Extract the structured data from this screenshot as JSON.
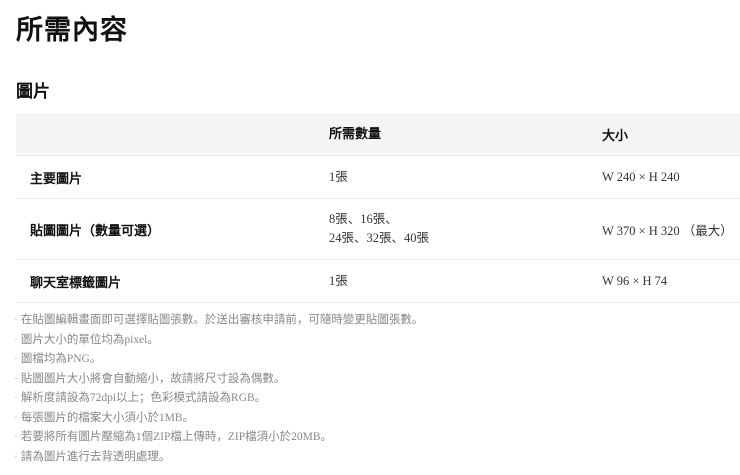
{
  "title": "所需內容",
  "section": "圖片",
  "table": {
    "headers": [
      "",
      "所需數量",
      "大小"
    ],
    "rows": [
      {
        "name": "主要圖片",
        "qty": [
          "1張"
        ],
        "size": "W 240 × H 240"
      },
      {
        "name": "貼圖圖片（數量可選）",
        "qty": [
          "8張、16張、",
          "24張、32張、40張"
        ],
        "size": "W 370 × H 320 （最大）"
      },
      {
        "name": "聊天室標籤圖片",
        "qty": [
          "1張"
        ],
        "size": "W 96 × H 74"
      }
    ]
  },
  "notes": [
    "在貼圖編輯畫面即可選擇貼圖張數。於送出審核申請前，可隨時變更貼圖張數。",
    "圖片大小的單位均為pixel。",
    "圖檔均為PNG。",
    "貼圖圖片大小將會自動縮小，故請將尺寸設為偶數。",
    "解析度請設為72dpi以上；色彩模式請設為RGB。",
    "每張圖片的檔案大小須小於1MB。",
    "若要將所有圖片壓縮為1個ZIP檔上傳時，ZIP檔須小於20MB。",
    "請為圖片進行去背透明處理。"
  ]
}
